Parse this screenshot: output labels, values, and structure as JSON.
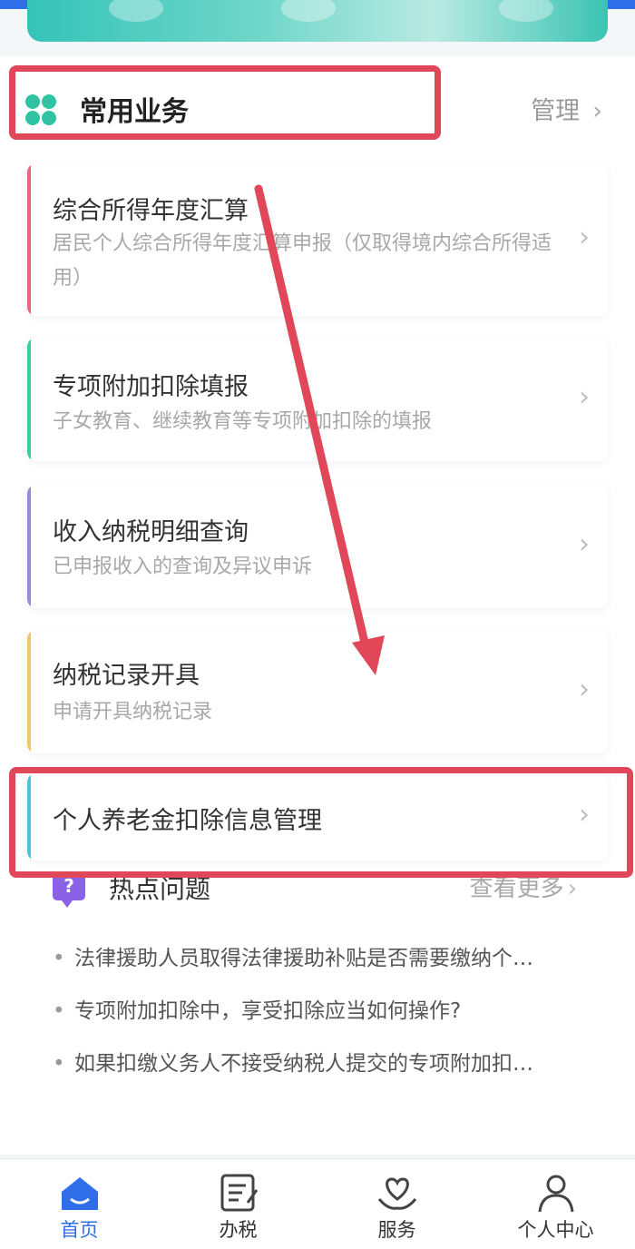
{
  "section": {
    "title": "常用业务",
    "manage_label": "管理",
    "chevron": "›"
  },
  "services": [
    {
      "title": "综合所得年度汇算",
      "desc": "居民个人综合所得年度汇算申报（仅取得境内综合所得适用）",
      "accent": "#e8677a"
    },
    {
      "title": "专项附加扣除填报",
      "desc": "子女教育、继续教育等专项附加扣除的填报",
      "accent": "#3ccf97"
    },
    {
      "title": "收入纳税明细查询",
      "desc": "已申报收入的查询及异议申诉",
      "accent": "#9b86e0"
    },
    {
      "title": "纳税记录开具",
      "desc": "申请开具纳税记录",
      "accent": "#f1c76a"
    },
    {
      "title": "个人养老金扣除信息管理",
      "desc": "",
      "accent": "#4fc1e0"
    }
  ],
  "hot": {
    "icon_glyph": "?",
    "title": "热点问题",
    "more_label": "查看更多",
    "items": [
      "法律援助人员取得法律援助补贴是否需要缴纳个…",
      "专项附加扣除中，享受扣除应当如何操作?",
      "如果扣缴义务人不接受纳税人提交的专项附加扣…"
    ]
  },
  "nav": {
    "items": [
      {
        "label": "首页",
        "icon": "home-icon",
        "active": true
      },
      {
        "label": "办税",
        "icon": "tax-form-icon",
        "active": false
      },
      {
        "label": "服务",
        "icon": "heart-hands-icon",
        "active": false
      },
      {
        "label": "个人中心",
        "icon": "person-icon",
        "active": false
      }
    ]
  },
  "colors": {
    "brand_blue": "#2f6ee8",
    "highlight_red": "#e0485a",
    "clover_green": "#2fc3a4",
    "hot_purple": "#8a62e6"
  }
}
